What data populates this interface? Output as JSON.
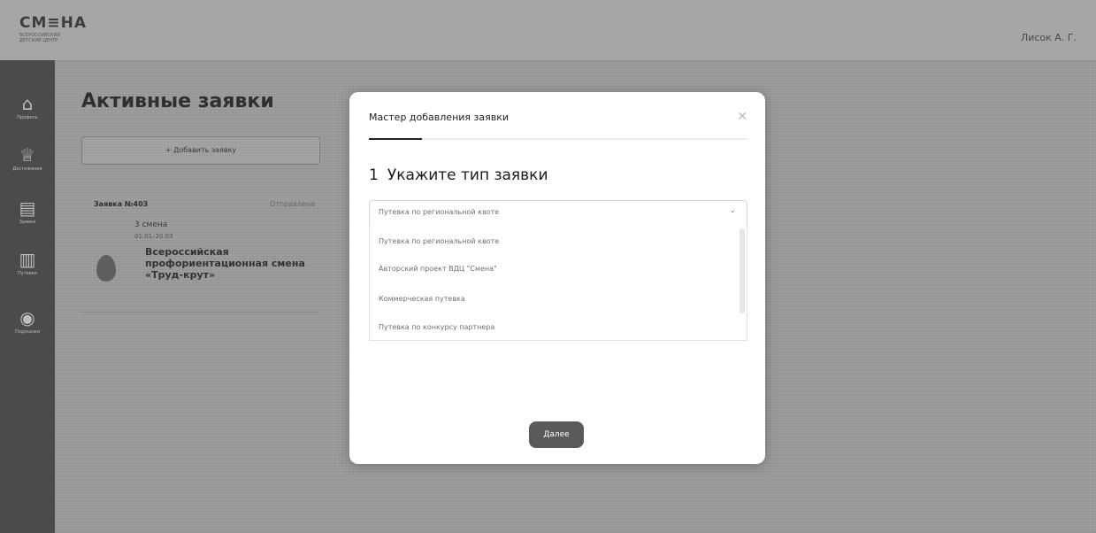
{
  "header": {
    "logo": "СМ≡НА",
    "logo_sub": "ВСЕРОССИЙСКИЙ ДЕТСКИЙ ЦЕНТР",
    "user": "Лисок А. Г."
  },
  "sidebar": {
    "items": [
      {
        "icon": "profile-icon",
        "glyph": "⌂",
        "label": "Профиль"
      },
      {
        "icon": "trophy-icon",
        "glyph": "♕",
        "label": "Достижения"
      },
      {
        "icon": "document-icon",
        "glyph": "▤",
        "label": "Заявки"
      },
      {
        "icon": "voucher-icon",
        "glyph": "▥",
        "label": "Путевки"
      },
      {
        "icon": "globe-icon",
        "glyph": "◉",
        "label": "Подсказки"
      }
    ]
  },
  "main": {
    "title": "Активные заявки",
    "add_button": "+ Добавить заявку",
    "card": {
      "number": "Заявка №403",
      "status": "Отправлена",
      "shift": "3 смена",
      "dates": "01.01–20.03",
      "program": "Всероссийская профориентационная смена «Труд-крут»"
    }
  },
  "modal": {
    "title": "Мастер добавления заявки",
    "close": "✕",
    "progress": 0.14,
    "step_number": "1",
    "step_title": "Укажите тип заявки",
    "select_value": "Путевка по региональной квоте",
    "select_arrow": "⌄",
    "options": [
      "Путевка по региональной квоте",
      "Авторский проект ВДЦ \"Смена\"",
      "Коммерческая путевка",
      "Путевка по конкурсу партнера"
    ],
    "next_button": "Далее"
  }
}
